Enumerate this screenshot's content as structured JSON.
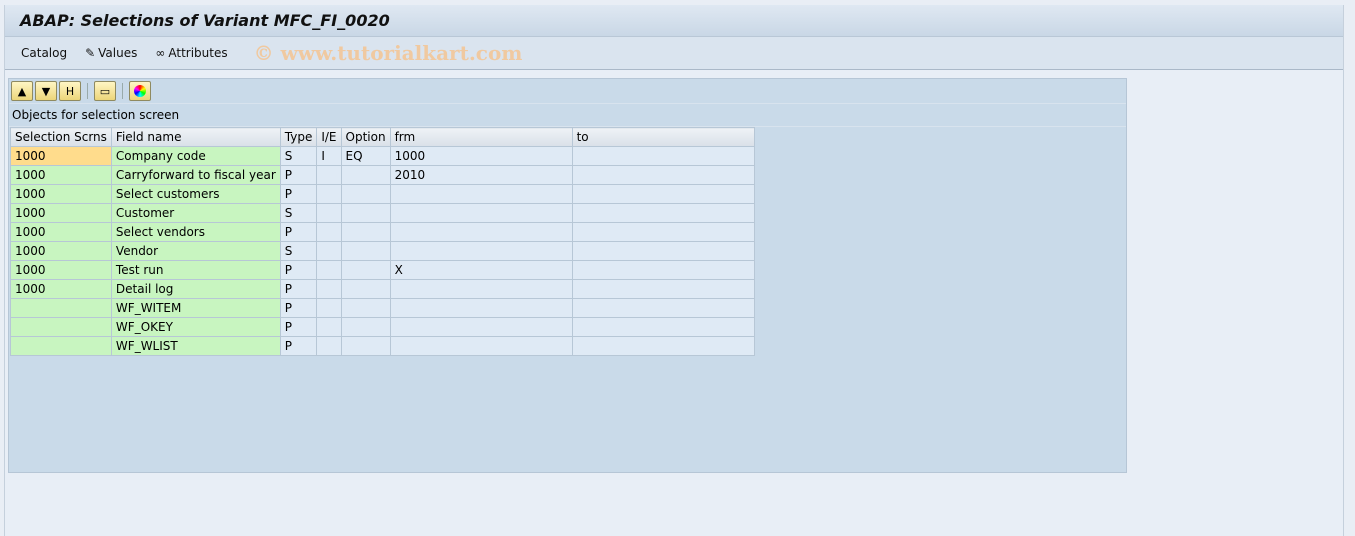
{
  "title": "ABAP: Selections of Variant MFC_FI_0020",
  "toolbar": {
    "catalog": "Catalog",
    "values": "Values",
    "attributes": "Attributes"
  },
  "watermark": "© www.tutorialkart.com",
  "caption": "Objects for selection screen",
  "icons": [
    "sort-ascending-icon",
    "filter-icon",
    "find-icon",
    "print-icon",
    "color-legend-icon"
  ],
  "columns": [
    "Selection Scrns",
    "Field name",
    "Type",
    "I/E",
    "Option",
    "frm",
    "to"
  ],
  "rows": [
    [
      "1000",
      "Company code",
      "S",
      "I",
      "EQ",
      "1000",
      ""
    ],
    [
      "1000",
      "Carryforward to fiscal year",
      "P",
      "",
      "",
      "2010",
      ""
    ],
    [
      "1000",
      "Select customers",
      "P",
      "",
      "",
      "",
      ""
    ],
    [
      "1000",
      "Customer",
      "S",
      "",
      "",
      "",
      ""
    ],
    [
      "1000",
      "Select vendors",
      "P",
      "",
      "",
      "",
      ""
    ],
    [
      "1000",
      "Vendor",
      "S",
      "",
      "",
      "",
      ""
    ],
    [
      "1000",
      "Test run",
      "P",
      "",
      "",
      "X",
      ""
    ],
    [
      "1000",
      "Detail log",
      "P",
      "",
      "",
      "",
      ""
    ],
    [
      "",
      "WF_WITEM",
      "P",
      "",
      "",
      "",
      ""
    ],
    [
      "",
      "WF_OKEY",
      "P",
      "",
      "",
      "",
      ""
    ],
    [
      "",
      "WF_WLIST",
      "P",
      "",
      "",
      "",
      ""
    ]
  ]
}
